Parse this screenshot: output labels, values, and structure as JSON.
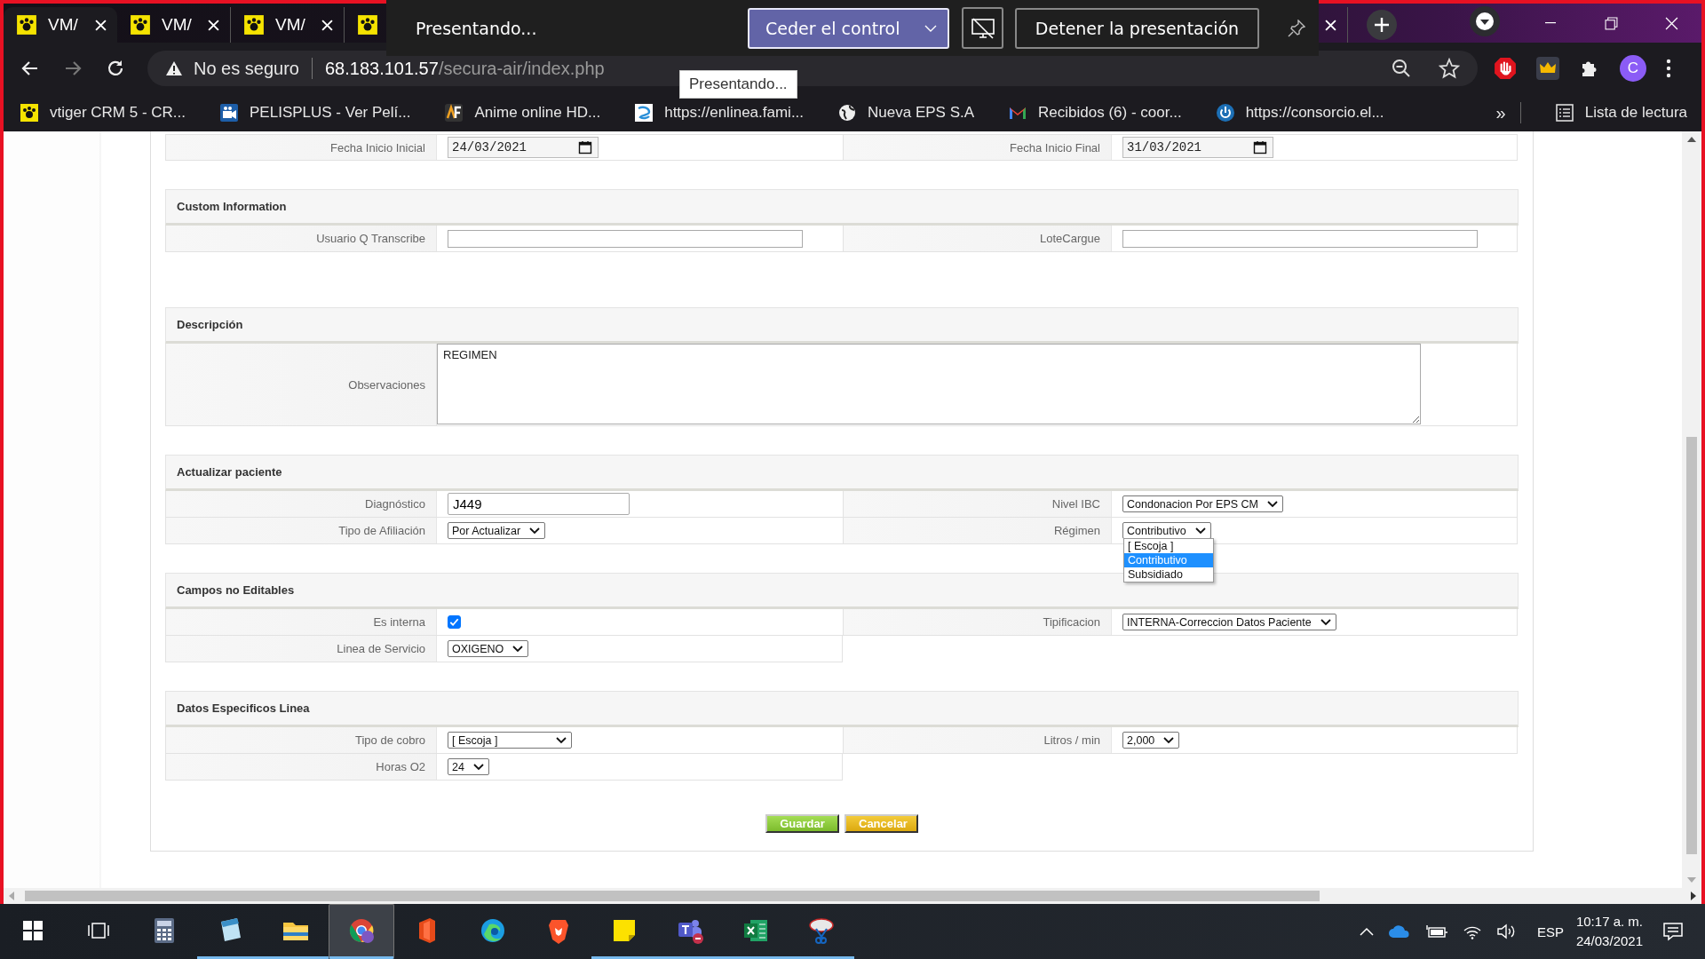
{
  "browser": {
    "tabs": [
      {
        "label": "VM/",
        "selected": true
      },
      {
        "label": "VM/",
        "selected": false
      },
      {
        "label": "VM/",
        "selected": false
      },
      {
        "selected": false
      }
    ],
    "address": {
      "security": "No es seguro",
      "host": "68.183.101.57",
      "path": "/secura-air/index.php"
    },
    "profile": "C",
    "bookmarks": [
      "vtiger CRM 5 - CR...",
      "PELISPLUS - Ver Pelí...",
      "Anime online HD...",
      "https://enlinea.fami...",
      "Nueva EPS S.A",
      "Recibidos (6) - coor...",
      "https://consorcio.el..."
    ],
    "overflow": "»",
    "reading_list": "Lista de lectura"
  },
  "share_bar": {
    "status": "Presentando...",
    "control_button": "Ceder el control",
    "stop_button": "Detener la presentación",
    "tooltip": "Presentando..."
  },
  "form": {
    "sections": [
      {
        "rows": [
          {
            "cells": [
              {
                "label": "Fecha Inicio Inicial",
                "field": {
                  "kind": "date",
                  "value": "24/03/2021"
                }
              },
              {
                "label": "Fecha Inicio Final",
                "field": {
                  "kind": "date",
                  "value": "31/03/2021"
                }
              }
            ]
          }
        ]
      },
      {
        "title": "Custom Information",
        "rows": [
          {
            "cells": [
              {
                "label": "Usuario Q Transcribe",
                "field": {
                  "kind": "text"
                }
              },
              {
                "label": "LoteCargue",
                "field": {
                  "kind": "text"
                }
              }
            ]
          }
        ]
      },
      {
        "title": "Descripción",
        "rows": [
          {
            "cells": [
              {
                "label": "Observaciones",
                "field": {
                  "kind": "textarea",
                  "value": "REGIMEN"
                }
              }
            ]
          }
        ]
      },
      {
        "title": "Actualizar paciente",
        "rows": [
          {
            "cells": [
              {
                "label": "Diagnóstico",
                "field": {
                  "kind": "text",
                  "value": "J449"
                }
              },
              {
                "label": "Nivel IBC",
                "field": {
                  "kind": "select",
                  "value": "Condonacion Por EPS CM"
                }
              }
            ]
          },
          {
            "cells": [
              {
                "label": "Tipo de Afiliación",
                "field": {
                  "kind": "select",
                  "value": "Por Actualizar"
                }
              },
              {
                "label": "Régimen",
                "field": {
                  "kind": "select",
                  "value": "Contributivo",
                  "expanded": true,
                  "options": [
                    {
                      "label": "[ Escoja ]",
                      "selected": false
                    },
                    {
                      "label": "Contributivo",
                      "selected": true
                    },
                    {
                      "label": "Subsidiado",
                      "selected": false
                    }
                  ]
                }
              }
            ]
          }
        ]
      },
      {
        "title": "Campos no Editables",
        "rows": [
          {
            "cells": [
              {
                "label": "Es interna",
                "field": {
                  "kind": "checkbox",
                  "checked": true
                }
              },
              {
                "label": "Tipificacion",
                "field": {
                  "kind": "select",
                  "value": "INTERNA-Correccion Datos Paciente"
                }
              }
            ]
          },
          {
            "cells": [
              {
                "label": "Linea de Servicio",
                "field": {
                  "kind": "select",
                  "value": "OXIGENO"
                }
              }
            ]
          }
        ]
      },
      {
        "title": "Datos Especificos Linea",
        "rows": [
          {
            "cells": [
              {
                "label": "Tipo de cobro",
                "field": {
                  "kind": "select",
                  "value": "[ Escoja ]"
                }
              },
              {
                "label": "Litros / min",
                "field": {
                  "kind": "select",
                  "value": "2,000"
                }
              }
            ]
          },
          {
            "cells": [
              {
                "label": "Horas O2",
                "field": {
                  "kind": "select",
                  "value": "24"
                }
              }
            ]
          }
        ]
      }
    ],
    "buttons": [
      {
        "label": "Guardar",
        "kind": "save"
      },
      {
        "label": "Cancelar",
        "kind": "cancel"
      }
    ]
  },
  "taskbar": {
    "apps": [
      {
        "running": false,
        "selected": false
      },
      {
        "running": true,
        "selected": false
      },
      {
        "running": true,
        "selected": false
      },
      {
        "running": true,
        "selected": true
      },
      {
        "running": false,
        "selected": false
      },
      {
        "running": false,
        "selected": false
      },
      {
        "running": false,
        "selected": false
      },
      {
        "running": true,
        "selected": false
      },
      {
        "running": true,
        "selected": false
      },
      {
        "running": true,
        "selected": false
      },
      {
        "running": true,
        "selected": false
      }
    ],
    "language": "ESP",
    "time": "10:17 a. m.",
    "date": "24/03/2021"
  }
}
